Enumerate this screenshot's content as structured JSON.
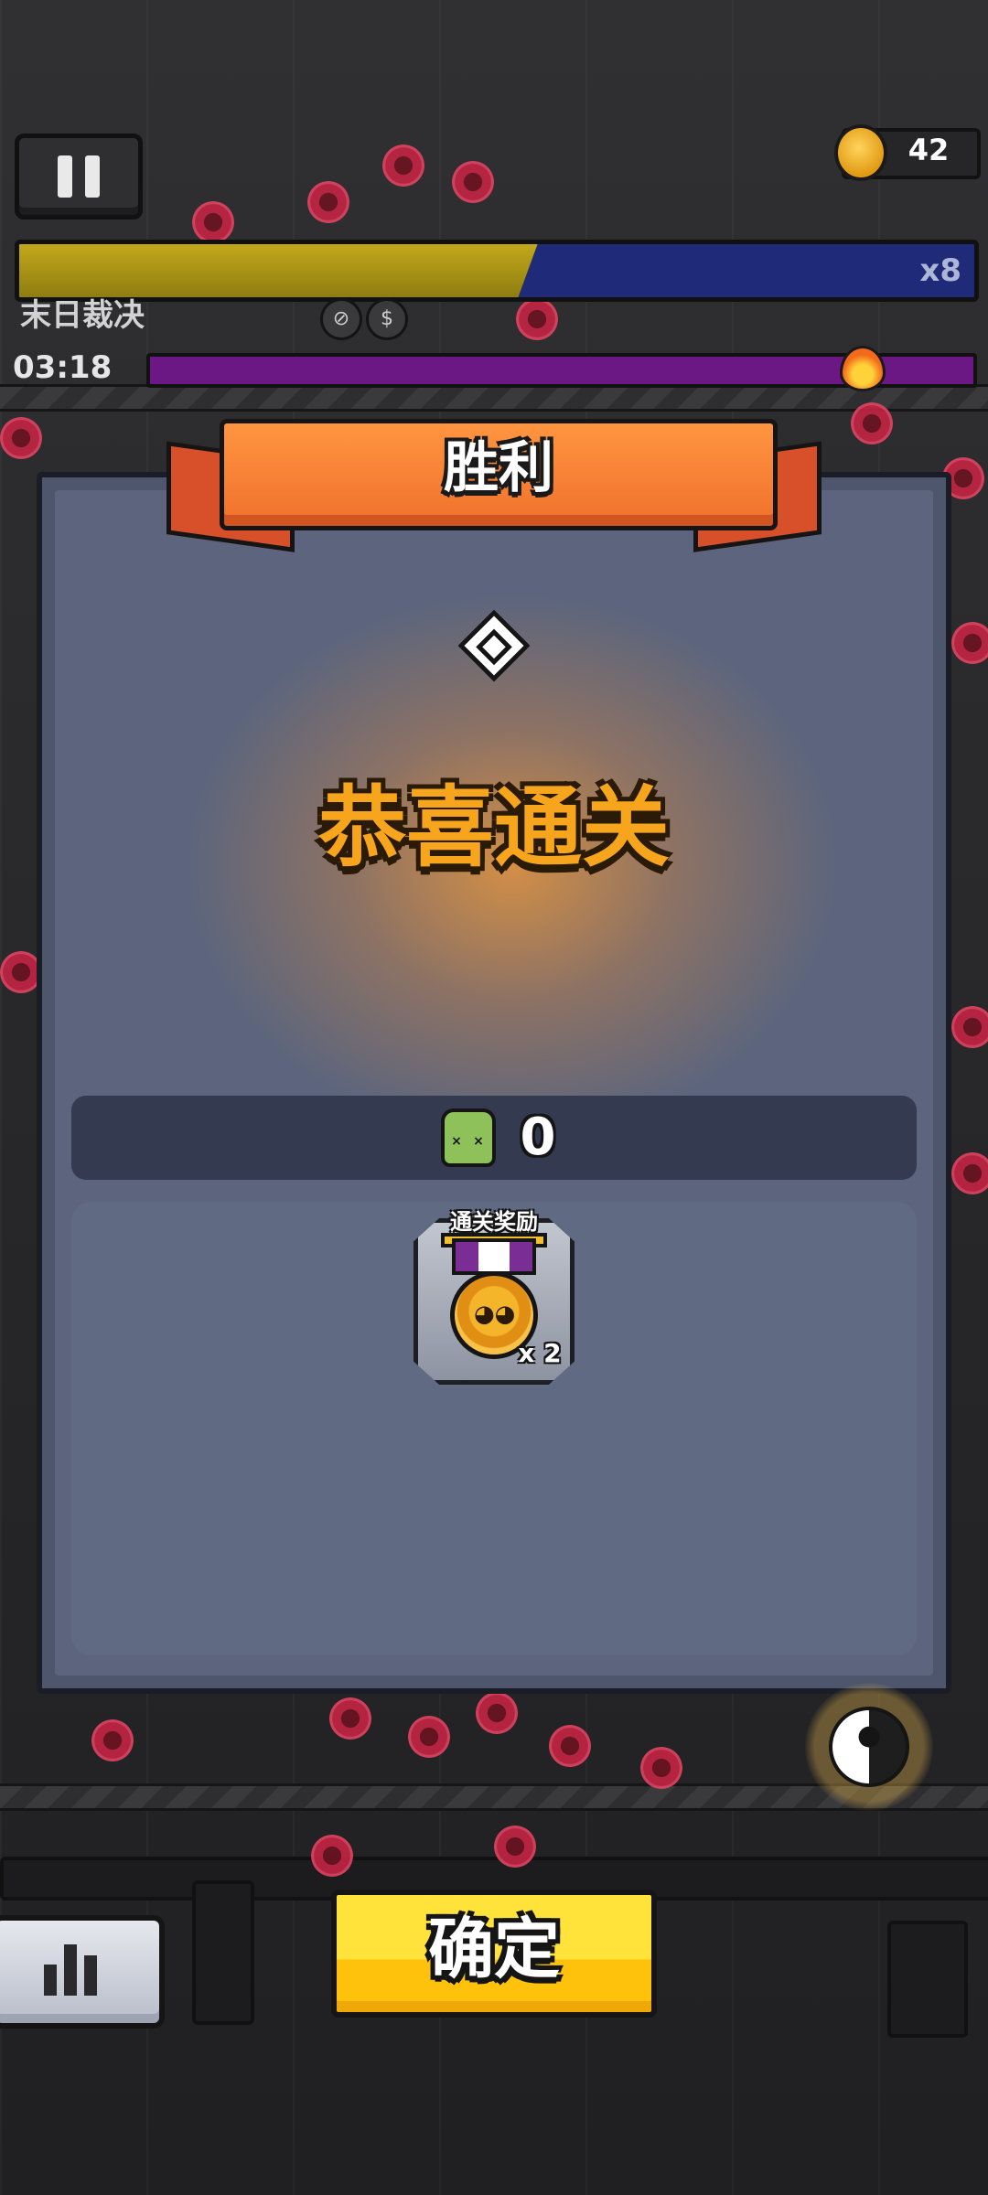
{
  "hud": {
    "coins": "42",
    "boss_multiplier": "x8",
    "boss_name": "末日裁决",
    "timer": "03:18",
    "boss_hp_fraction": 0.55
  },
  "dialog": {
    "banner_title": "胜利",
    "congrats_text": "恭喜通关",
    "kills_value": "0",
    "reward_label": "通关奖励",
    "reward_quantity": "x 2"
  },
  "actions": {
    "confirm_label": "确定"
  },
  "icons": {
    "pause": "pause-icon",
    "coin": "coin-icon",
    "fire": "fire-icon",
    "diamond": "diamond-icon",
    "zombie": "zombie-kill-icon",
    "medal": "medal-icon",
    "stats": "bar-chart-icon",
    "yinyang": "yin-yang-paw-icon"
  },
  "colors": {
    "banner": "#f0702c",
    "congrats_text": "#f7a51c",
    "confirm_button": "#ffd21f",
    "dialog_bg": "#5c657d",
    "timer_bar": "#6b1885",
    "hp_fill": "#c2a81a",
    "hp_track": "#1f2a78"
  }
}
